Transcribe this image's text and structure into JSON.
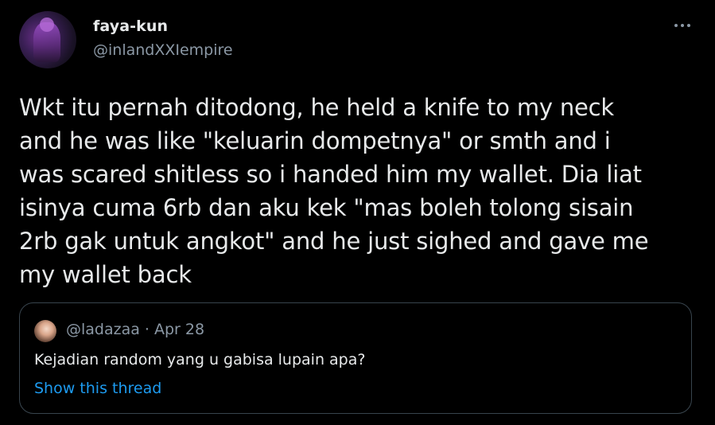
{
  "tweet": {
    "author": {
      "name": "faya-kun",
      "handle": "@inlandXXIempire"
    },
    "more_icon": "more-horizontal-icon",
    "text": "Wkt itu pernah ditodong, he held a knife to my neck\nand he was like \"keluarin dompetnya\" or smth and i\nwas scared shitless so i handed him my wallet. Dia liat\nisinya cuma 6rb dan aku kek \"mas boleh tolong sisain\n2rb gak untuk angkot\" and he just sighed and gave me\nmy wallet back"
  },
  "quoted_tweet": {
    "handle_and_date": "@ladazaa · Apr 28",
    "text": "Kejadian random yang u gabisa lupain apa?",
    "show_thread_label": "Show this thread"
  },
  "colors": {
    "background": "#000000",
    "text_primary": "#e7e9ea",
    "text_secondary": "#8b98a5",
    "link": "#1d9bf0",
    "border": "#38444d"
  }
}
